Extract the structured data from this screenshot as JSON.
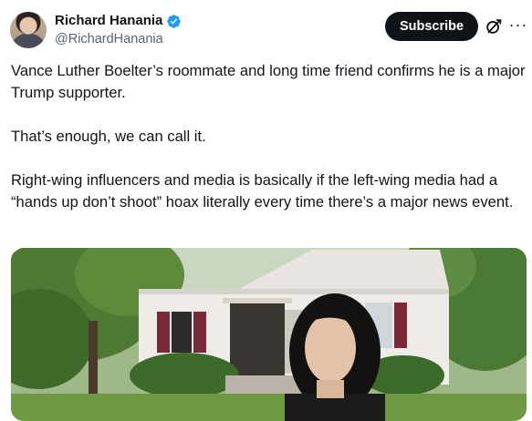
{
  "author": {
    "display_name": "Richard Hanania",
    "handle": "@RichardHanania"
  },
  "actions": {
    "subscribe_label": "Subscribe",
    "more_label": "···"
  },
  "tweet": {
    "text": "Vance Luther Boelter’s roommate and long time friend confirms he is a major Trump supporter.\n\nThat’s enough, we can call it.\n\nRight-wing influencers and media is basically if the left-wing media had a “hands up don’t shoot” hoax literally every time there’s a major news event."
  },
  "colors": {
    "verified_blue": "#1d9bf0",
    "subscribe_bg": "#0f1419",
    "handle_gray": "#536471"
  },
  "icons": {
    "verified": "verified-badge-icon",
    "grok": "grok-icon",
    "more": "more-options-icon"
  }
}
